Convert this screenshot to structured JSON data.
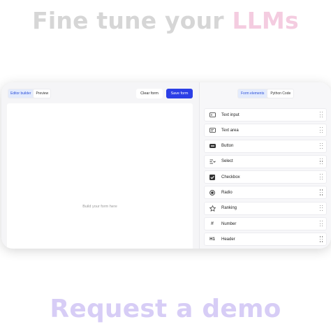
{
  "headline": {
    "part1": "Fine tune your ",
    "part2": "LLMs"
  },
  "footer": {
    "cta": "Request a demo"
  },
  "editor": {
    "tabs": [
      {
        "label": "Editor builder",
        "active": true
      },
      {
        "label": "Preview",
        "active": false
      }
    ],
    "clear_label": "Clear form",
    "save_label": "Save form",
    "canvas_placeholder": "Build your form here"
  },
  "sidebar": {
    "tabs": [
      {
        "label": "Form elements",
        "active": true
      },
      {
        "label": "Python Code",
        "active": false
      }
    ],
    "items": [
      {
        "label": "Text input",
        "icon": "text-input-icon"
      },
      {
        "label": "Text area",
        "icon": "text-area-icon"
      },
      {
        "label": "Button",
        "icon": "button-icon"
      },
      {
        "label": "Select",
        "icon": "select-icon"
      },
      {
        "label": "Checkbox",
        "icon": "checkbox-icon"
      },
      {
        "label": "Radio",
        "icon": "radio-icon"
      },
      {
        "label": "Ranking",
        "icon": "star-icon"
      },
      {
        "label": "Number",
        "icon": "hash-icon",
        "glyph": "#"
      },
      {
        "label": "Header",
        "icon": "header-icon",
        "glyph": "H1"
      }
    ]
  },
  "colors": {
    "accent": "#2c3fe6",
    "tab_active_bg": "#e3ebfd",
    "headline_grey": "#d6d6d6",
    "headline_pink": "#f4cce0",
    "cta_lavender": "#d7cdf6"
  }
}
